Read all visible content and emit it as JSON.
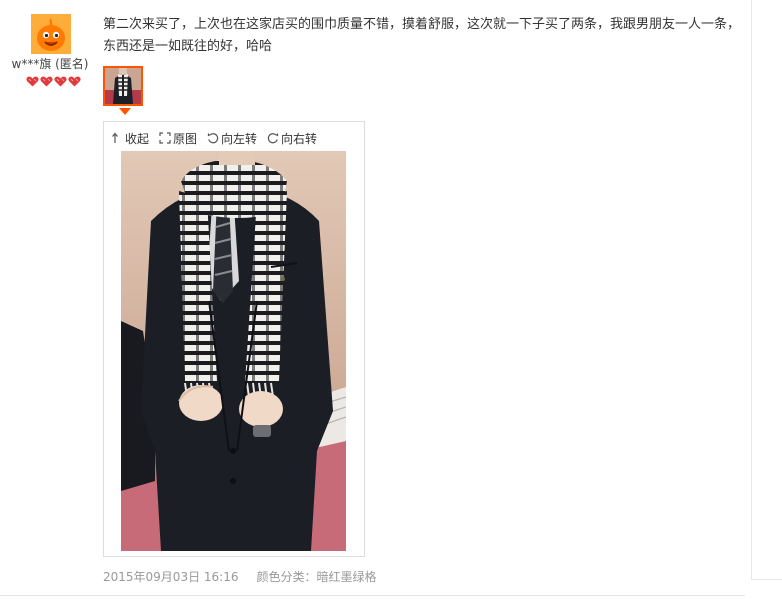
{
  "user": {
    "name": "w***旗 (匿名)",
    "rating_icon": "red-heart-icon",
    "rating_count": 4,
    "accent": "#e4393c",
    "avatar_color": "#ffa21f"
  },
  "review": {
    "text": "第二次来买了，上次也在这家店买的围巾质量不错，摸着舒服，这次就一下子买了两条，我跟男朋友一人一条，东西还是一如既往的好，哈哈"
  },
  "thumbnail": {
    "selected": true,
    "border_color": "#ff5500"
  },
  "viewer": {
    "toolbar": {
      "collapse": "收起",
      "original": "原图",
      "rotate_left": "向左转",
      "rotate_right": "向右转"
    },
    "icons": [
      "collapse-arrow-icon",
      "expand-icon",
      "rotate-left-icon",
      "rotate-right-icon"
    ]
  },
  "meta": {
    "date": "2015年09月03日 16:16",
    "sku": "颜色分类：暗红墨绿格"
  }
}
